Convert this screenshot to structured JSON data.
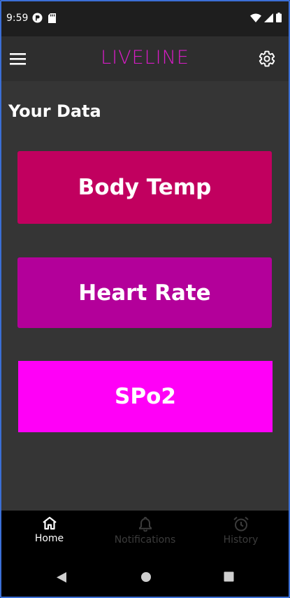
{
  "status_bar": {
    "time": "9:59",
    "icons_left": [
      "notification-p-icon",
      "sd-card-icon"
    ],
    "icons_right": [
      "wifi-icon",
      "signal-icon",
      "battery-icon"
    ]
  },
  "app_bar": {
    "title": "LIVELINE",
    "title_color": "#d81cc6",
    "menu_icon": "hamburger-menu-icon",
    "settings_icon": "gear-icon"
  },
  "page": {
    "heading": "Your Data"
  },
  "cards": [
    {
      "label": "Body Temp",
      "color": "#c1005f"
    },
    {
      "label": "Heart Rate",
      "color": "#b3009a"
    },
    {
      "label": "SPo2",
      "color": "#ff00f7"
    }
  ],
  "bottom_nav": {
    "items": [
      {
        "label": "Home",
        "icon": "home-icon",
        "active": true
      },
      {
        "label": "Notifications",
        "icon": "bell-icon",
        "active": false
      },
      {
        "label": "History",
        "icon": "alarm-clock-icon",
        "active": false
      }
    ]
  },
  "system_nav": {
    "buttons": [
      "back-icon",
      "home-circle-icon",
      "recents-icon"
    ]
  }
}
